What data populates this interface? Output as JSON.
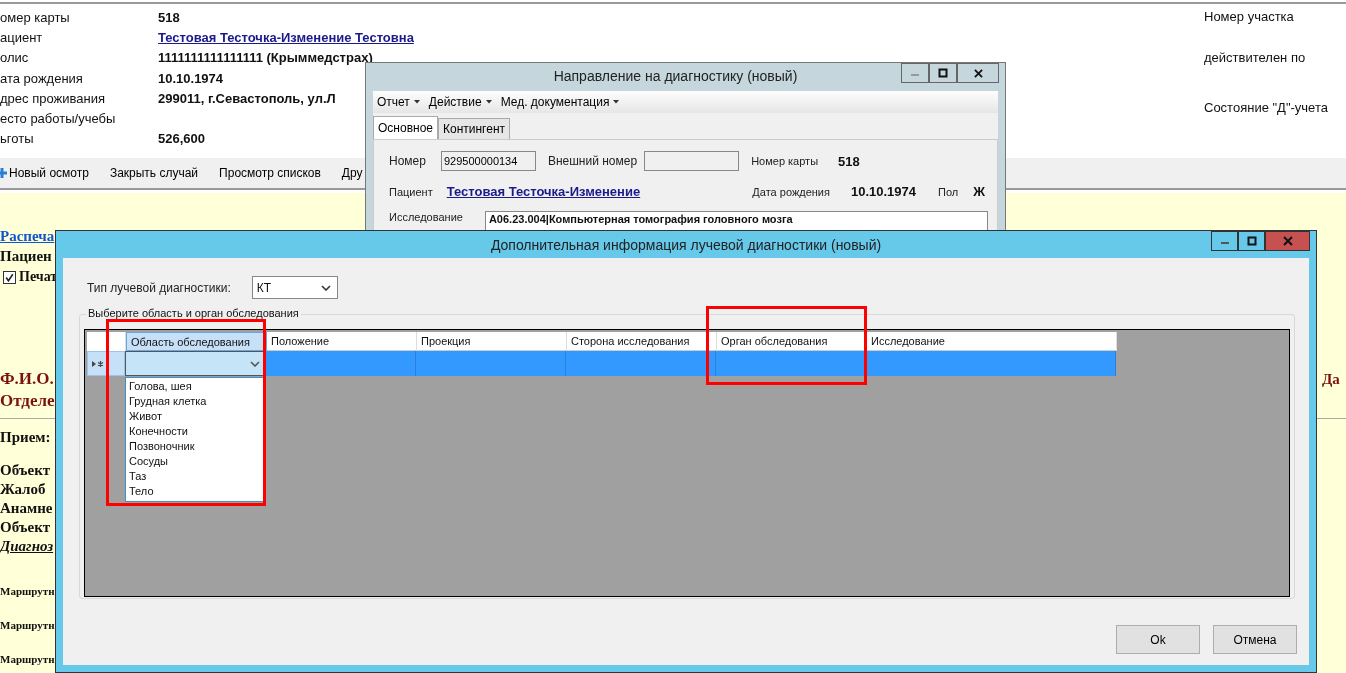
{
  "background_page": {
    "patient_fields": [
      {
        "label": "омер карты",
        "value": "518",
        "kind": "text"
      },
      {
        "label": "ациент",
        "value": "Тестовая Тесточка-Изменение Тестовна",
        "kind": "link"
      },
      {
        "label": "олис",
        "value": "1111111111111111 (Крыммедстрах)",
        "kind": "text"
      },
      {
        "label": "ата рождения",
        "value": "10.10.1974",
        "kind": "text"
      },
      {
        "label": "дрес проживания",
        "value": "299011, г.Севастополь, ул.Л",
        "kind": "text"
      },
      {
        "label": "есто работы/учебы",
        "kind": "empty"
      },
      {
        "label": "ьготы",
        "value": "526,600",
        "kind": "text"
      }
    ],
    "right_labels": [
      "Номер участка",
      "действителен по",
      "Состояние \"Д\"-учета"
    ],
    "toolbar": [
      {
        "label": "Новый осмотр",
        "kind": "add"
      },
      {
        "label": "Закрыть случай",
        "kind": "plain"
      },
      {
        "label": "Просмотр списков",
        "kind": "plain"
      },
      {
        "label": "Дру",
        "kind": "plain"
      }
    ],
    "document_blocks": [
      [
        {
          "text": "Распеча",
          "kind": "link"
        },
        {
          "text": "Пациен",
          "kind": "bold"
        },
        {
          "text": "Печат",
          "kind": "checkbox",
          "checked": true
        }
      ],
      [
        {
          "text": "Ф.И.О.",
          "kind": "heading"
        },
        {
          "text": "Отделе",
          "kind": "heading"
        }
      ],
      [
        {
          "text": "Прием:",
          "kind": "bold"
        }
      ],
      [
        {
          "text": "Объект",
          "kind": "bold"
        },
        {
          "text": "Жалоб",
          "kind": "bold"
        },
        {
          "text": "Анамне",
          "kind": "bold"
        },
        {
          "text": "Объект",
          "kind": "bold"
        },
        {
          "text": "Диагноз",
          "kind": "diagnosis"
        }
      ],
      [
        {
          "text": "Маршрутн",
          "kind": "small"
        },
        {
          "text": "Маршрутн",
          "kind": "small"
        },
        {
          "text": "Маршрутн",
          "kind": "small"
        }
      ]
    ],
    "side_label": "Да"
  },
  "direction_window": {
    "title": "Направление на диагностику (новый)",
    "menu": [
      "Отчет",
      "Действие",
      "Мед. документация"
    ],
    "tabs": [
      {
        "label": "Основное",
        "selected": true
      },
      {
        "label": "Контингент",
        "selected": false
      }
    ],
    "number_label": "Номер",
    "number_value": "929500000134",
    "external_number_label": "Внешний номер",
    "card_number_label": "Номер карты",
    "card_number": "518",
    "patient_label": "Пациент",
    "patient": "Тестовая Тесточка-Изменение ",
    "birth_date_label": "Дата рождения",
    "birth_date": "10.10.1974",
    "sex_label": "Пол",
    "sex": "Ж",
    "study_label": "Исследование",
    "study": "A06.23.004|Компьютерная томография головного мозга"
  },
  "radiology_window": {
    "title": "Дополнительная информация лучевой диагностики (новый)",
    "type_label": "Тип лучевой диагностики:",
    "type_value": "КТ",
    "group_title": "Выберите область и орган обследования",
    "columns": [
      {
        "label": "Область обследования",
        "selected": true
      },
      {
        "label": "Положение",
        "selected": false
      },
      {
        "label": "Проекция",
        "selected": false
      },
      {
        "label": "Сторона исследования",
        "selected": false
      },
      {
        "label": "Орган обследования",
        "selected": false
      },
      {
        "label": "Исследование",
        "selected": false
      }
    ],
    "row_selected": true,
    "dropdown_options": [
      "Голова, шея",
      "Грудная клетка",
      "Живот",
      "Конечности",
      "Позвоночник",
      "Сосуды",
      "Таз",
      "Тело"
    ],
    "buttons": [
      "Ok",
      "Отмена"
    ]
  }
}
